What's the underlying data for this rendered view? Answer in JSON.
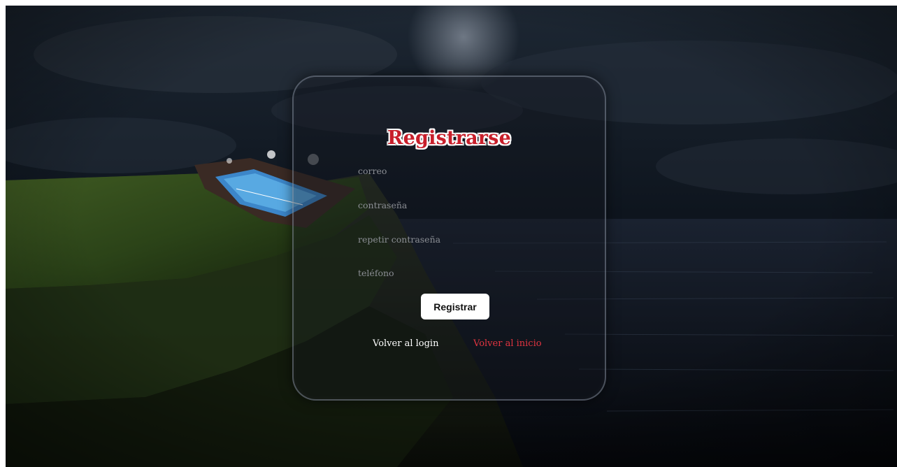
{
  "form": {
    "title": "Registrarse",
    "fields": [
      {
        "placeholder": "correo",
        "value": ""
      },
      {
        "placeholder": "contraseña",
        "value": ""
      },
      {
        "placeholder": "repetir contraseña",
        "value": ""
      },
      {
        "placeholder": "teléfono",
        "value": ""
      }
    ],
    "submit_label": "Registrar",
    "links": {
      "login": "Volver al login",
      "home": "Volver al inicio"
    }
  },
  "colors": {
    "title": "#c81f2b",
    "title_outline": "#ffffff",
    "home_link": "#e13440",
    "login_link": "#ffffff",
    "button_bg": "#ffffff"
  },
  "background": {
    "scene": "night-cliff-over-sea-with-padel-stadium",
    "icons": [
      "stadium-icon"
    ]
  }
}
